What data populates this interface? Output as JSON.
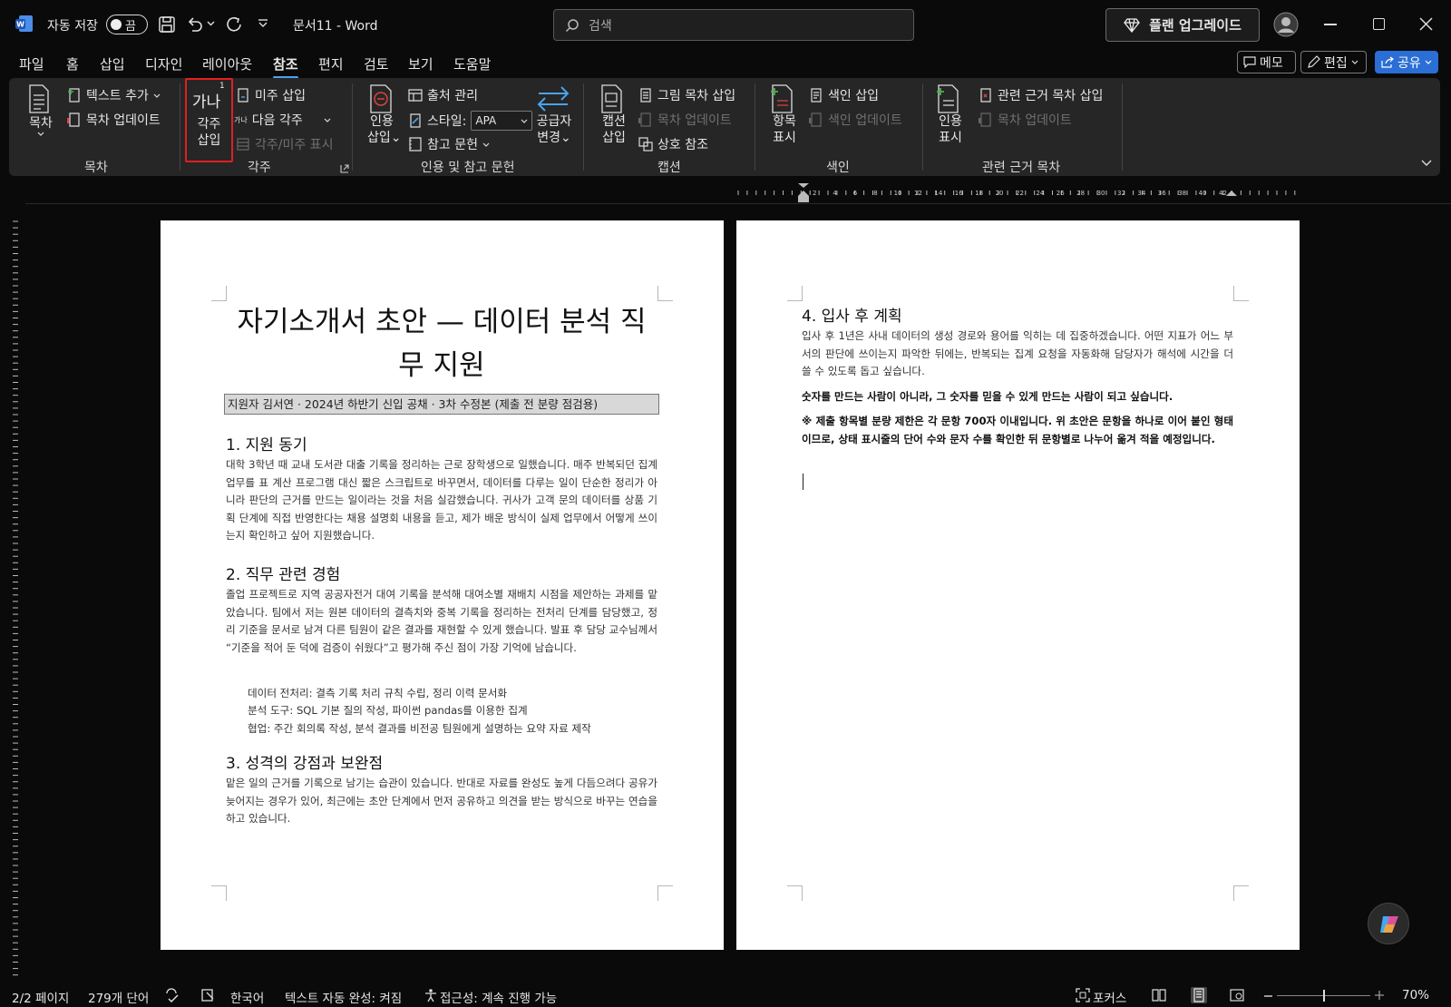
{
  "titlebar": {
    "autosave_label": "자동 저장",
    "autosave_state": "끔",
    "doc_title": "문서11  -  Word",
    "search_placeholder": "검색",
    "upgrade_label": "플랜 업그레이드"
  },
  "menu": {
    "tabs": [
      "파일",
      "홈",
      "삽입",
      "디자인",
      "레이아웃",
      "참조",
      "편지",
      "검토",
      "보기",
      "도움말"
    ],
    "active_tab": "참조",
    "memo_label": "메모",
    "edit_label": "편집",
    "share_label": "공유"
  },
  "ribbon": {
    "toc": {
      "big_label": "목차",
      "add_text": "텍스트 추가",
      "update_toc": "목차 업데이트",
      "group": "목차"
    },
    "footnotes": {
      "big_icon_text": "가나",
      "big_label_1": "각주",
      "big_label_2": "삽입",
      "insert_endnote": "미주 삽입",
      "next_footnote": "다음 각주",
      "show_notes": "각주/미주 표시",
      "group": "각주"
    },
    "citations": {
      "big_label_1": "인용",
      "big_label_2": "삽입",
      "manage_sources": "출처 관리",
      "style_label": "스타일:",
      "style_value": "APA",
      "bibliography": "참고 문헌",
      "provider_1": "공급자",
      "provider_2": "변경",
      "group": "인용 및 참고 문헌"
    },
    "captions": {
      "big_label_1": "캡션",
      "big_label_2": "삽입",
      "insert_tof": "그림 목차 삽입",
      "update_table": "목차 업데이트",
      "cross_ref": "상호 참조",
      "group": "캡션"
    },
    "index": {
      "big_label_1": "항목",
      "big_label_2": "표시",
      "insert_index": "색인 삽입",
      "update_index": "색인 업데이트",
      "group": "색인"
    },
    "authorities": {
      "big_label_1": "인용",
      "big_label_2": "표시",
      "insert_toa": "관련 근거 목차 삽입",
      "update_table": "목차 업데이트",
      "group": "관련 근거 목차"
    }
  },
  "document": {
    "page1": {
      "title_line1": "자기소개서 초안 — 데이터 분석 직",
      "title_line2": "무 지원",
      "subtitle": "지원자 김서연 · 2024년 하반기 신입 공채 · 3차 수정본 (제출 전 분량 점검용)",
      "h1": "1. 지원 동기",
      "p1": "대학 3학년 때 교내 도서관 대출 기록을 정리하는 근로 장학생으로 일했습니다. 매주 반복되던 집계 업무를 표 계산 프로그램 대신 짧은 스크립트로 바꾸면서, 데이터를 다루는 일이 단순한 정리가 아니라 판단의 근거를 만드는 일이라는 것을 처음 실감했습니다. 귀사가 고객 문의 데이터를 상품 기획 단계에 직접 반영한다는 채용 설명회 내용을 듣고, 제가 배운 방식이 실제 업무에서 어떻게 쓰이는지 확인하고 싶어 지원했습니다.",
      "h2": "2. 직무 관련 경험",
      "p2": "졸업 프로젝트로 지역 공공자전거 대여 기록을 분석해 대여소별 재배치 시점을 제안하는 과제를 맡았습니다. 팀에서 저는 원본 데이터의 결측치와 중복 기록을 정리하는 전처리 단계를 담당했고, 정리 기준을 문서로 남겨 다른 팀원이 같은 결과를 재현할 수 있게 했습니다. 발표 후 담당 교수님께서 “기준을 적어 둔 덕에 검증이 쉬웠다”고 평가해 주신 점이 가장 기억에 남습니다.",
      "bullets": [
        "데이터 전처리: 결측 기록 처리 규칙 수립, 정리 이력 문서화",
        "분석 도구: SQL 기본 질의 작성, 파이썬 pandas를 이용한 집계",
        "협업: 주간 회의록 작성, 분석 결과를 비전공 팀원에게 설명하는 요약 자료 제작"
      ],
      "h3": "3. 성격의 강점과 보완점",
      "p3": "맡은 일의 근거를 기록으로 남기는 습관이 있습니다. 반대로 자료를 완성도 높게 다듬으려다 공유가 늦어지는 경우가 있어, 최근에는 초안 단계에서 먼저 공유하고 의견을 받는 방식으로 바꾸는 연습을 하고 있습니다."
    },
    "page2": {
      "h4": "4. 입사 후 계획",
      "p4": "입사 후 1년은 사내 데이터의 생성 경로와 용어를 익히는 데 집중하겠습니다. 어떤 지표가 어느 부서의 판단에 쓰이는지 파악한 뒤에는, 반복되는 집계 요청을 자동화해 담당자가 해석에 시간을 더 쓸 수 있도록 돕고 싶습니다.",
      "bold1": "숫자를 만드는 사람이 아니라, 그 숫자를 믿을 수 있게 만드는 사람이 되고 싶습니다.",
      "bold2": "※ 제출 항목별 분량 제한은 각 문항 700자 이내입니다. 위 초안은 문항을 하나로 이어 붙인 형태이므로, 상태 표시줄의 단어 수와 문자 수를 확인한 뒤 문항별로 나누어 옮겨 적을 예정입니다."
    }
  },
  "statusbar": {
    "page": "2/2 페이지",
    "words": "279개 단어",
    "language": "한국어",
    "autocomplete": "텍스트 자동 완성: 켜짐",
    "accessibility": "접근성: 계속 진행 가능",
    "focus": "포커스",
    "zoom": "70%"
  },
  "ruler": {
    "numbers": [
      "2",
      "4",
      "6",
      "8",
      "10",
      "12",
      "14",
      "16",
      "18",
      "20",
      "22",
      "24",
      "26",
      "28",
      "30",
      "32",
      "34",
      "36",
      "38",
      "40",
      "42"
    ]
  },
  "colors": {
    "accent": "#4aa3f0",
    "share": "#2b6ed6",
    "highlight_border": "#e02020",
    "ribbon_bg": "#262626"
  }
}
